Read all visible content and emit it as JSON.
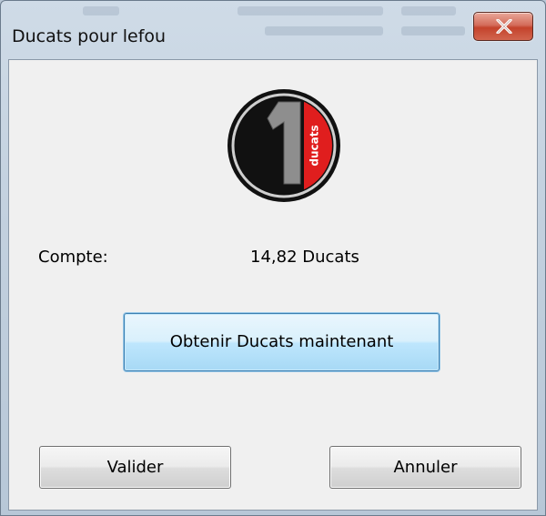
{
  "window": {
    "title": "Ducats pour lefou"
  },
  "logo": {
    "numeral": "1",
    "tag": "ducats"
  },
  "account": {
    "label": "Compte:",
    "value": "14,82 Ducats"
  },
  "buttons": {
    "get_ducats": "Obtenir Ducats maintenant",
    "ok": "Valider",
    "cancel": "Annuler"
  },
  "colors": {
    "close_button": "#c4432c",
    "logo_accent": "#e01e1e",
    "primary_button_border": "#3c7fb1"
  }
}
